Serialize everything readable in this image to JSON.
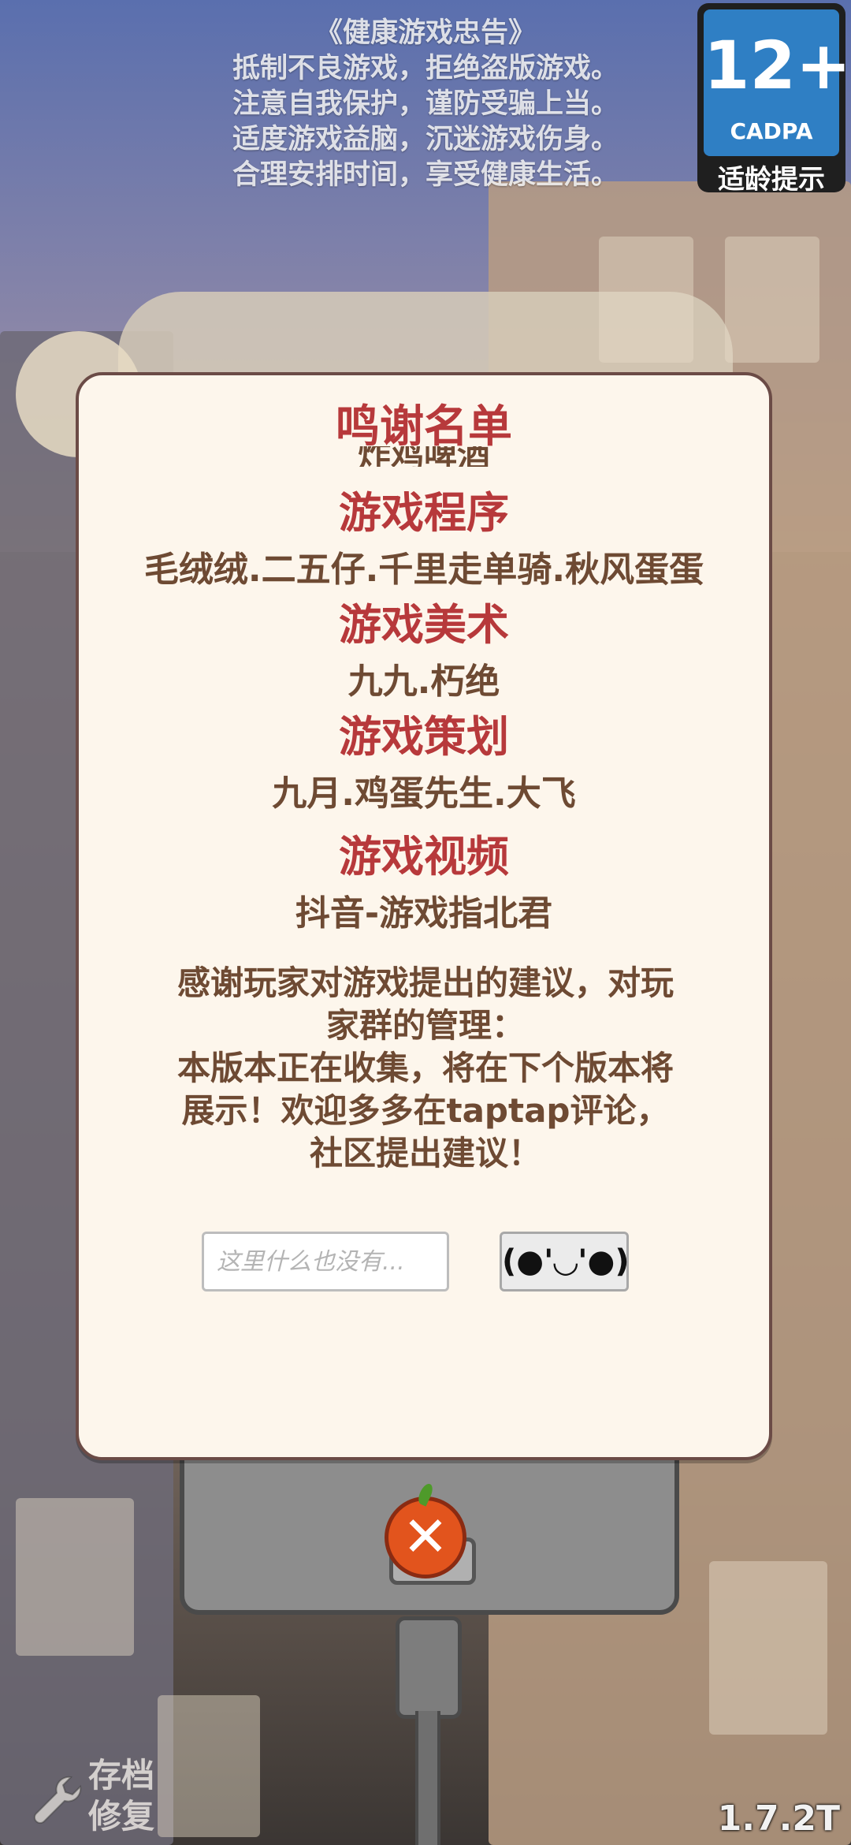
{
  "health_notice": {
    "title": "《健康游戏忠告》",
    "lines": [
      "抵制不良游戏，拒绝盗版游戏。",
      "注意自我保护，谨防受骗上当。",
      "适度游戏益脑，沉迷游戏伤身。",
      "合理安排时间，享受健康生活。"
    ]
  },
  "age_badge": {
    "rating": "12+",
    "org": "CADPA",
    "label": "适龄提示"
  },
  "credits_modal": {
    "title": "鸣谢名单",
    "scrolled_partial": "炸鸡啤酒",
    "sections": [
      {
        "heading": "游戏程序",
        "names": "毛绒绒.二五仔.千里走单骑.秋风蛋蛋"
      },
      {
        "heading": "游戏美术",
        "names": "九九.朽绝"
      },
      {
        "heading": "游戏策划",
        "names": "九月.鸡蛋先生.大飞"
      },
      {
        "heading": "游戏视频",
        "names": "抖音-游戏指北君"
      }
    ],
    "thanks_lines": [
      "感谢玩家对游戏提出的建议，对玩",
      "家群的管理：",
      "本版本正在收集，将在下个版本将",
      "展示！欢迎多多在taptap评论，",
      "社区提出建议！"
    ],
    "input_placeholder": "这里什么也没有...",
    "emoticon_button": "(●'◡'●)"
  },
  "close_icon": "close-icon",
  "repair": {
    "label_line1": "存档",
    "label_line2": "修复"
  },
  "version": "1.7.2T"
}
